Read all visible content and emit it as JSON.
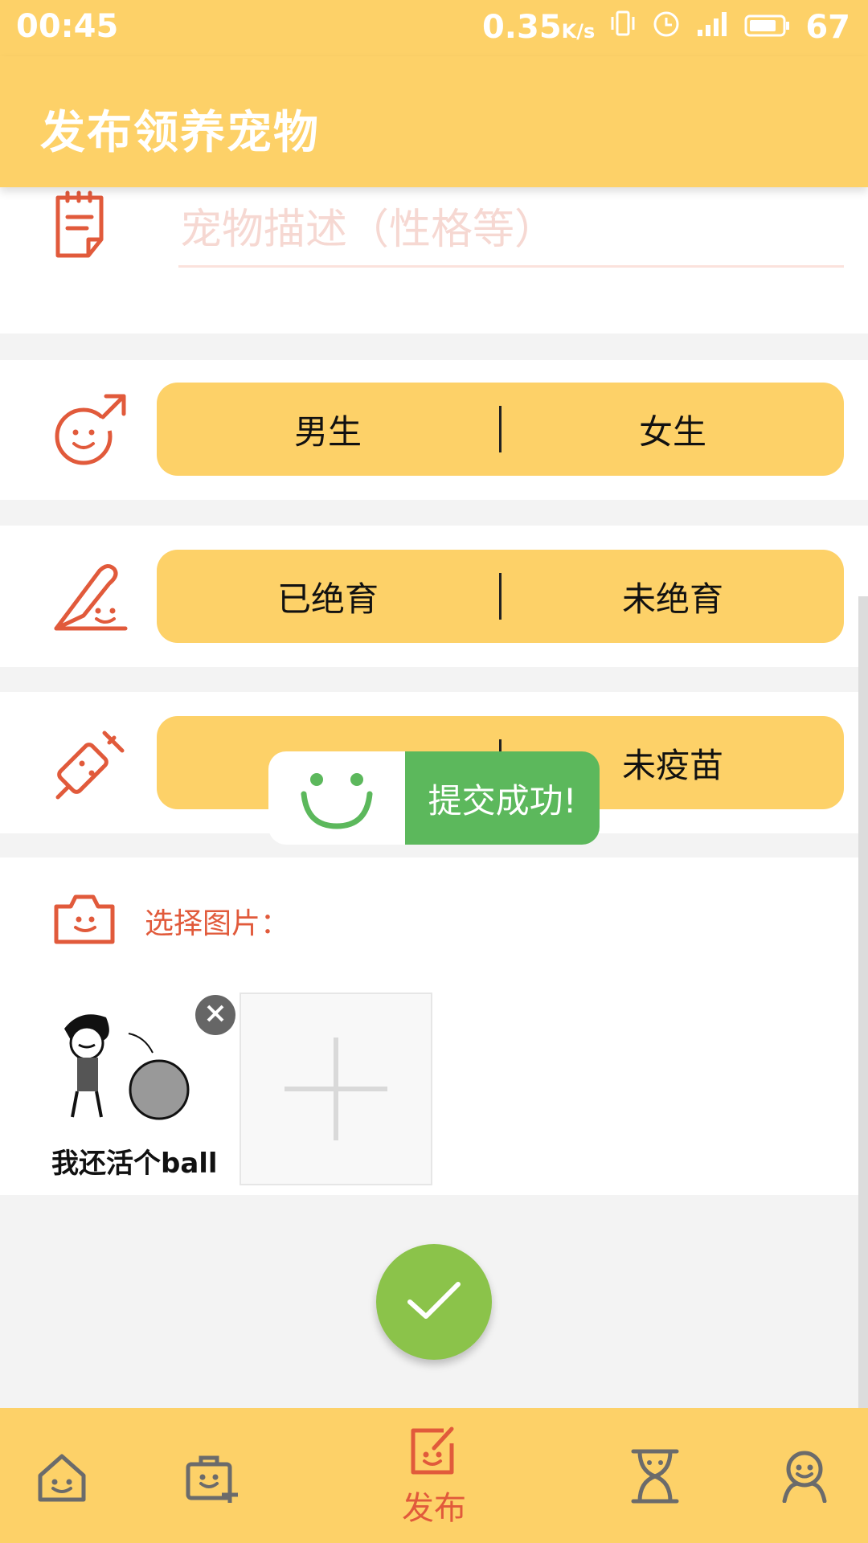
{
  "status_bar": {
    "time": "00:45",
    "network_speed": "0.35",
    "speed_unit": "K/s",
    "battery": "67"
  },
  "header": {
    "title": "发布领养宠物"
  },
  "form": {
    "description_placeholder": "宠物描述（性格等）",
    "gender": {
      "option_a": "男生",
      "option_b": "女生"
    },
    "neuter": {
      "option_a": "已绝育",
      "option_b": "未绝育"
    },
    "vaccine": {
      "option_b": "未疫苗"
    },
    "image_label": "选择图片：",
    "thumbnail_caption": "我还活个ball"
  },
  "toast": {
    "message": "提交成功!"
  },
  "bottom_nav": {
    "publish_label": "发布",
    "items": [
      "home-icon",
      "bag-add-icon",
      "publish-icon",
      "hourglass-icon",
      "profile-icon"
    ]
  },
  "colors": {
    "primary": "#fdd168",
    "accent": "#e15a3b",
    "success": "#5cb85c",
    "fab": "#8bc34a"
  }
}
